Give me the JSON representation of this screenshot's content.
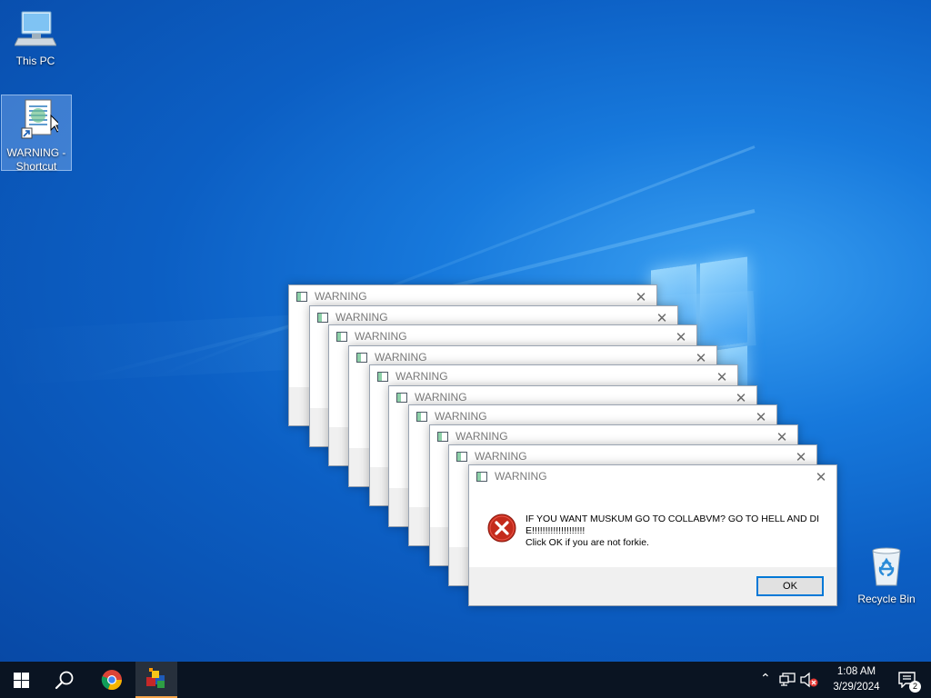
{
  "desktop": {
    "icons": [
      {
        "label": "This PC",
        "icon": "computer-icon"
      },
      {
        "label": "WARNING - Shortcut",
        "icon": "shortcut-script-icon",
        "selected": true
      },
      {
        "label": "Recycle Bin",
        "icon": "recycle-bin-icon"
      }
    ]
  },
  "dialogs": [
    {
      "title": "WARNING"
    },
    {
      "title": "WARNING"
    },
    {
      "title": "WARNING"
    },
    {
      "title": "WARNING"
    },
    {
      "title": "WARNING"
    },
    {
      "title": "WARNING"
    },
    {
      "title": "WARNING"
    },
    {
      "title": "WARNING"
    },
    {
      "title": "WARNING"
    },
    {
      "title": "WARNING",
      "close_glyph": "✕",
      "message_line1": "IF YOU WANT MUSKUM GO TO COLLABVM? GO TO HELL AND DIE!!!!!!!!!!!!!!!!!!!!",
      "message_line2": "Click OK if you are not forkie.",
      "ok_label": "OK",
      "icon": "error-icon"
    }
  ],
  "taskbar": {
    "start": "windows-start-icon",
    "search": "search-icon",
    "apps": [
      "chrome-icon",
      "app-cubes-icon"
    ],
    "active_app": "app-cubes-icon",
    "tray": {
      "overflow": "chevron-up-icon",
      "network": "network-icon",
      "volume": "volume-muted-icon",
      "time": "1:08 AM",
      "date": "3/29/2024",
      "notification_count": "2"
    }
  },
  "colors": {
    "desktop_blue": "#0c5fc4",
    "taskbar": "#0a1422",
    "error_red": "#c42b1c",
    "ok_border": "#0078d7",
    "active_indicator": "#f7a64b"
  }
}
